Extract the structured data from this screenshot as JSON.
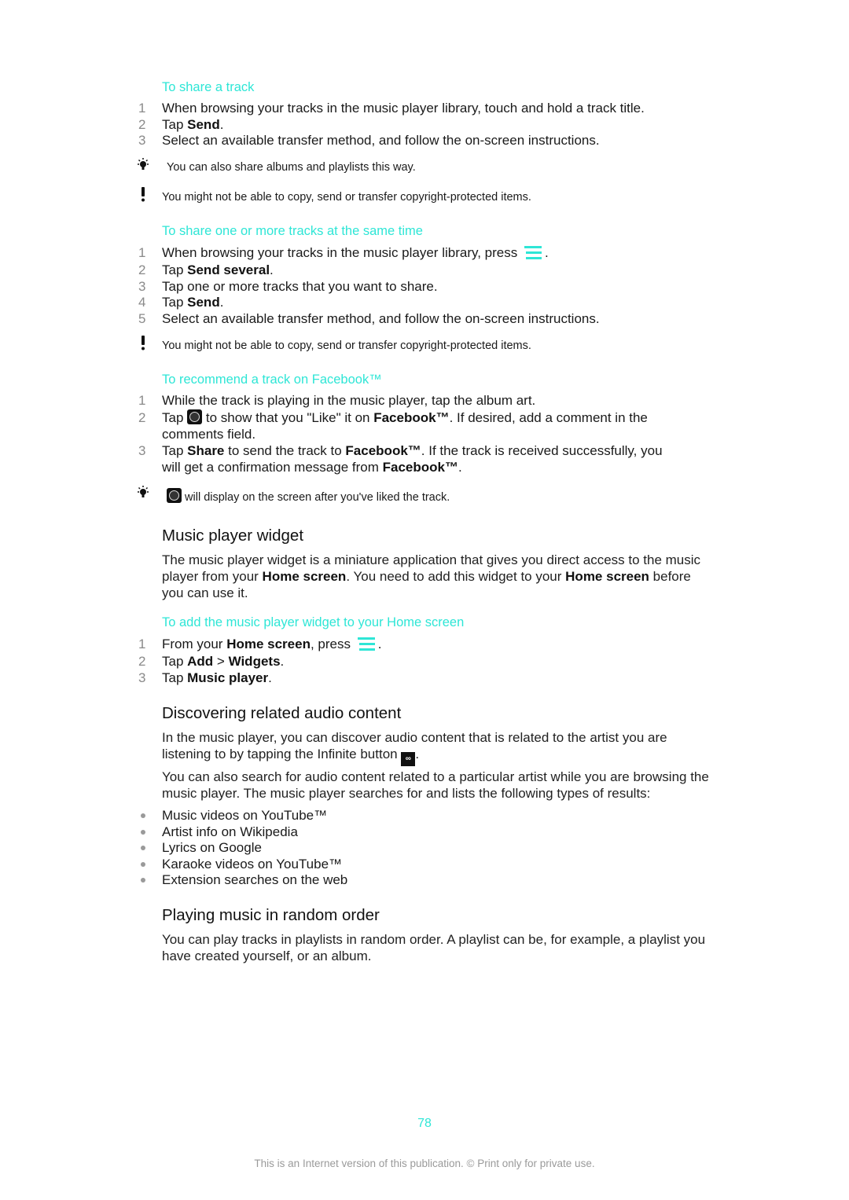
{
  "section_share_track": {
    "heading": "To share a track",
    "steps": [
      {
        "num": "1",
        "pre": "When browsing your tracks in the music player library, touch and hold a track title.",
        "bold": "",
        "post": ""
      },
      {
        "num": "2",
        "pre": "Tap ",
        "bold": "Send",
        "post": "."
      },
      {
        "num": "3",
        "pre": "Select an available transfer method, and follow the on-screen instructions.",
        "bold": "",
        "post": ""
      }
    ],
    "tip": "You can also share albums and playlists this way.",
    "warning": "You might not be able to copy, send or transfer copyright-protected items."
  },
  "section_share_several": {
    "heading": "To share one or more tracks at the same time",
    "step1_text": "When browsing your tracks in the music player library, press",
    "step1_after": ".",
    "steps": [
      {
        "num": "1"
      },
      {
        "num": "2",
        "pre": "Tap ",
        "bold": "Send several",
        "post": "."
      },
      {
        "num": "3",
        "pre": "Tap one or more tracks that you want to share.",
        "bold": "",
        "post": ""
      },
      {
        "num": "4",
        "pre": "Tap ",
        "bold": "Send",
        "post": "."
      },
      {
        "num": "5",
        "pre": "Select an available transfer method, and follow the on-screen instructions.",
        "bold": "",
        "post": ""
      }
    ],
    "warning": "You might not be able to copy, send or transfer copyright-protected items."
  },
  "section_facebook": {
    "heading": "To recommend a track on Facebook™",
    "step1": {
      "num": "1",
      "text": "While the track is playing in the music player, tap the album art."
    },
    "step2": {
      "num": "2",
      "a": "Tap ",
      "b": " to show that you \"Like\" it on ",
      "c": "Facebook™",
      "d": ". If desired, add a comment in the comments field."
    },
    "step3": {
      "num": "3",
      "a": "Tap ",
      "b": "Share",
      "c": " to send the track to ",
      "d": "Facebook™",
      "e": ". If the track is received successfully, you will get a confirmation message from ",
      "f": "Facebook™",
      "g": "."
    },
    "tip": "will display on the screen after you've liked the track."
  },
  "section_widget": {
    "title": "Music player widget",
    "para": {
      "a": "The music player widget is a miniature application that gives you direct access to the music player from your ",
      "b": "Home screen",
      "c": ". You need to add this widget to your ",
      "d": "Home screen",
      "e": " before you can use it."
    },
    "subheading": "To add the music player widget to your Home screen",
    "step1": {
      "num": "1",
      "a": "From your ",
      "b": "Home screen",
      "c": ", press",
      "d": "."
    },
    "step2": {
      "num": "2",
      "a": "Tap ",
      "b": "Add",
      "c": " > ",
      "d": "Widgets",
      "e": "."
    },
    "step3": {
      "num": "3",
      "a": "Tap ",
      "b": "Music player",
      "c": "."
    }
  },
  "section_discover": {
    "title": "Discovering related audio content",
    "para1": "In the music player, you can discover audio content that is related to the artist you are listening to by tapping the Infinite button",
    "para1_after": ".",
    "infinite_icon_glyph": "∞",
    "para2": "You can also search for audio content related to a particular artist while you are browsing the music player. The music player searches for and lists the following types of results:",
    "bullets": [
      "Music videos on YouTube™",
      "Artist info on Wikipedia",
      "Lyrics on Google",
      "Karaoke videos on YouTube™",
      "Extension searches on the web"
    ]
  },
  "section_random": {
    "title": "Playing music in random order",
    "para": "You can play tracks in playlists in random order. A playlist can be, for example, a playlist you have created yourself, or an album."
  },
  "page_number": "78",
  "footer": "This is an Internet version of this publication. © Print only for private use.",
  "colors": {
    "accent": "#2ee6d6",
    "step_number": "#8a8a8a",
    "footer": "#9a9a9a"
  }
}
